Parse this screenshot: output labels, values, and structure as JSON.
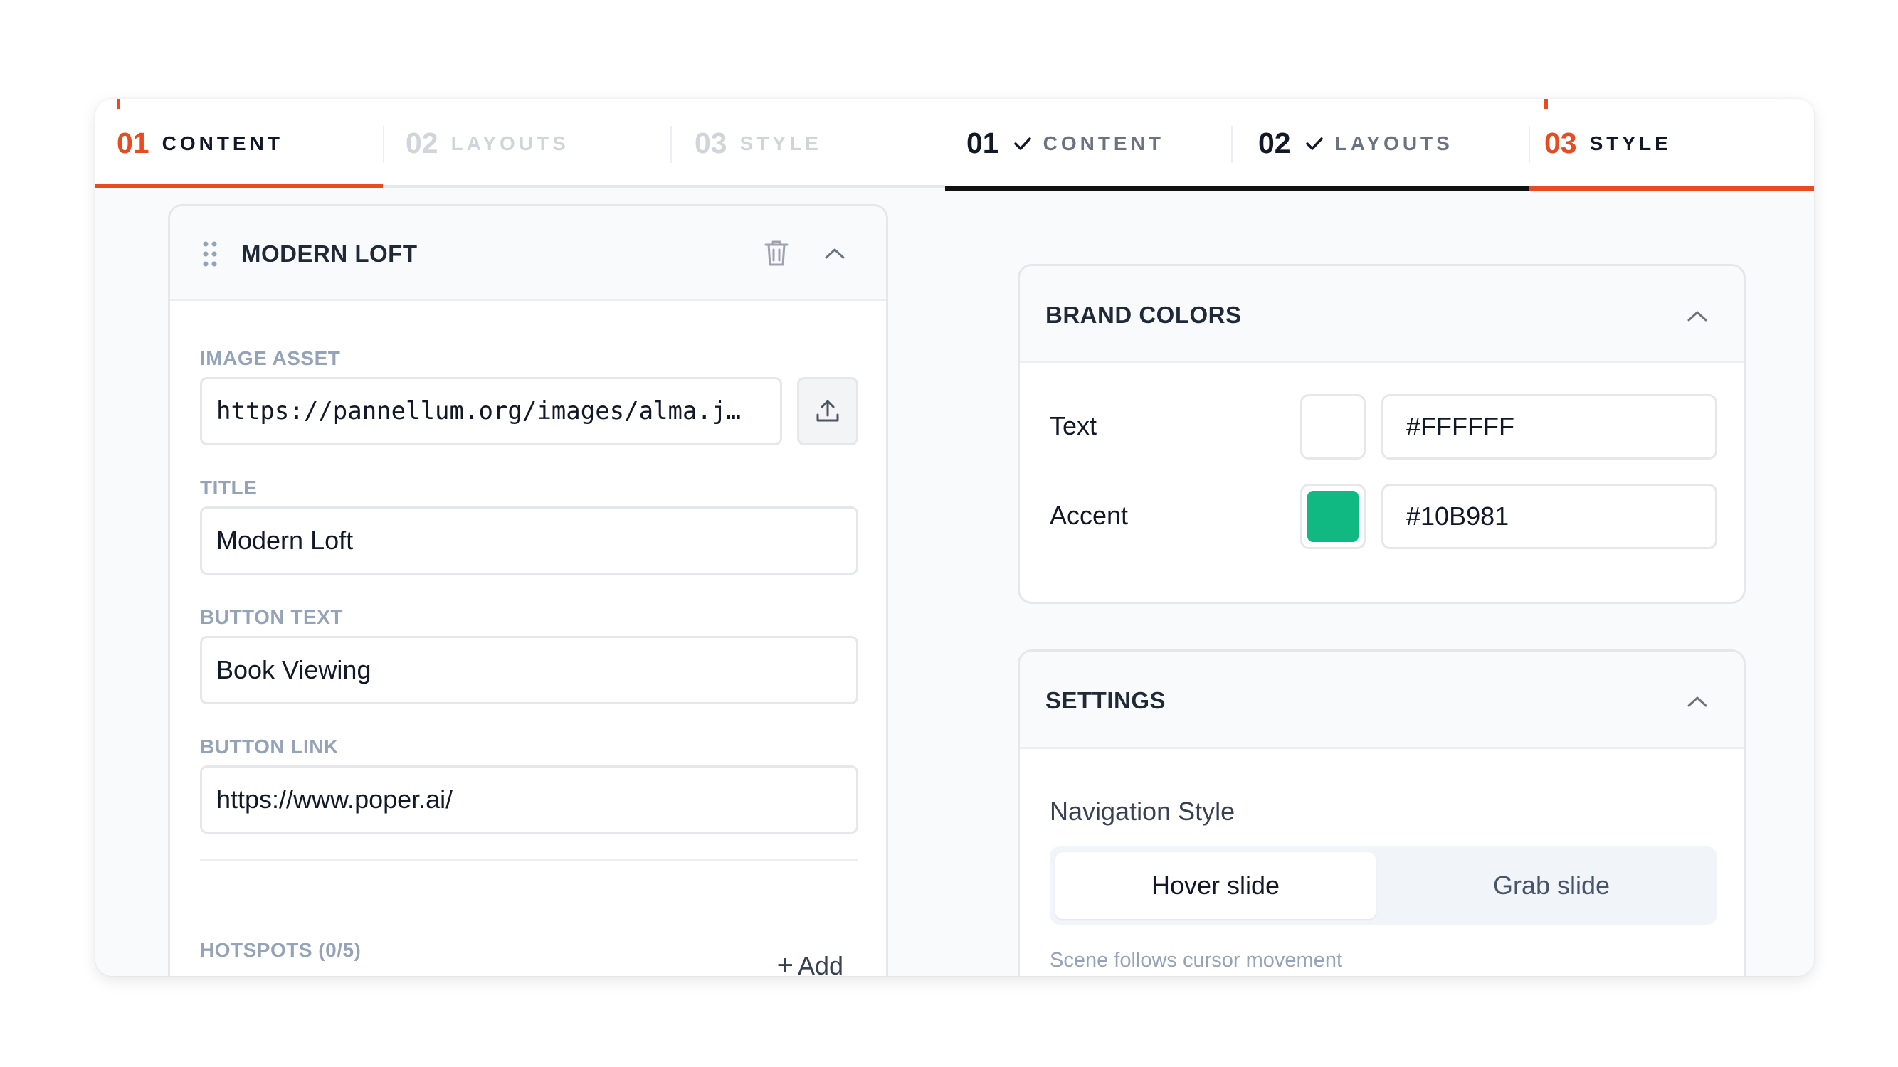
{
  "left_tabs": [
    {
      "num": "01",
      "label": "CONTENT",
      "state": "active"
    },
    {
      "num": "02",
      "label": "LAYOUTS",
      "state": "inactive"
    },
    {
      "num": "03",
      "label": "STYLE",
      "state": "inactive"
    }
  ],
  "right_tabs": [
    {
      "num": "01",
      "label": "CONTENT",
      "state": "done"
    },
    {
      "num": "02",
      "label": "LAYOUTS",
      "state": "done"
    },
    {
      "num": "03",
      "label": "STYLE",
      "state": "active"
    }
  ],
  "item": {
    "title": "MODERN LOFT",
    "fields": {
      "image_asset": {
        "label": "IMAGE ASSET",
        "value": "https://pannellum.org/images/alma.j…"
      },
      "title": {
        "label": "TITLE",
        "value": "Modern Loft"
      },
      "button_text": {
        "label": "BUTTON TEXT",
        "value": "Book Viewing"
      },
      "button_link": {
        "label": "BUTTON LINK",
        "value": "https://www.poper.ai/"
      }
    },
    "hotspots": {
      "label": "HOTSPOTS (0/5)",
      "add_label": "Add"
    }
  },
  "brand_colors": {
    "title": "BRAND COLORS",
    "rows": [
      {
        "label": "Text",
        "hex": "#FFFFFF",
        "swatch": "#FFFFFF"
      },
      {
        "label": "Accent",
        "hex": "#10B981",
        "swatch": "#10B981"
      }
    ]
  },
  "settings": {
    "title": "SETTINGS",
    "navigation_label": "Navigation Style",
    "options": [
      "Hover slide",
      "Grab slide"
    ],
    "selected": "Hover slide",
    "hint": "Scene follows cursor movement"
  },
  "colors": {
    "accent": "#ea4a1f",
    "dark": "#111827",
    "muted": "#94a3b8"
  },
  "icons": [
    "drag-handle-icon",
    "trash-icon",
    "chevron-up-icon",
    "upload-icon",
    "check-icon",
    "plus-icon"
  ]
}
